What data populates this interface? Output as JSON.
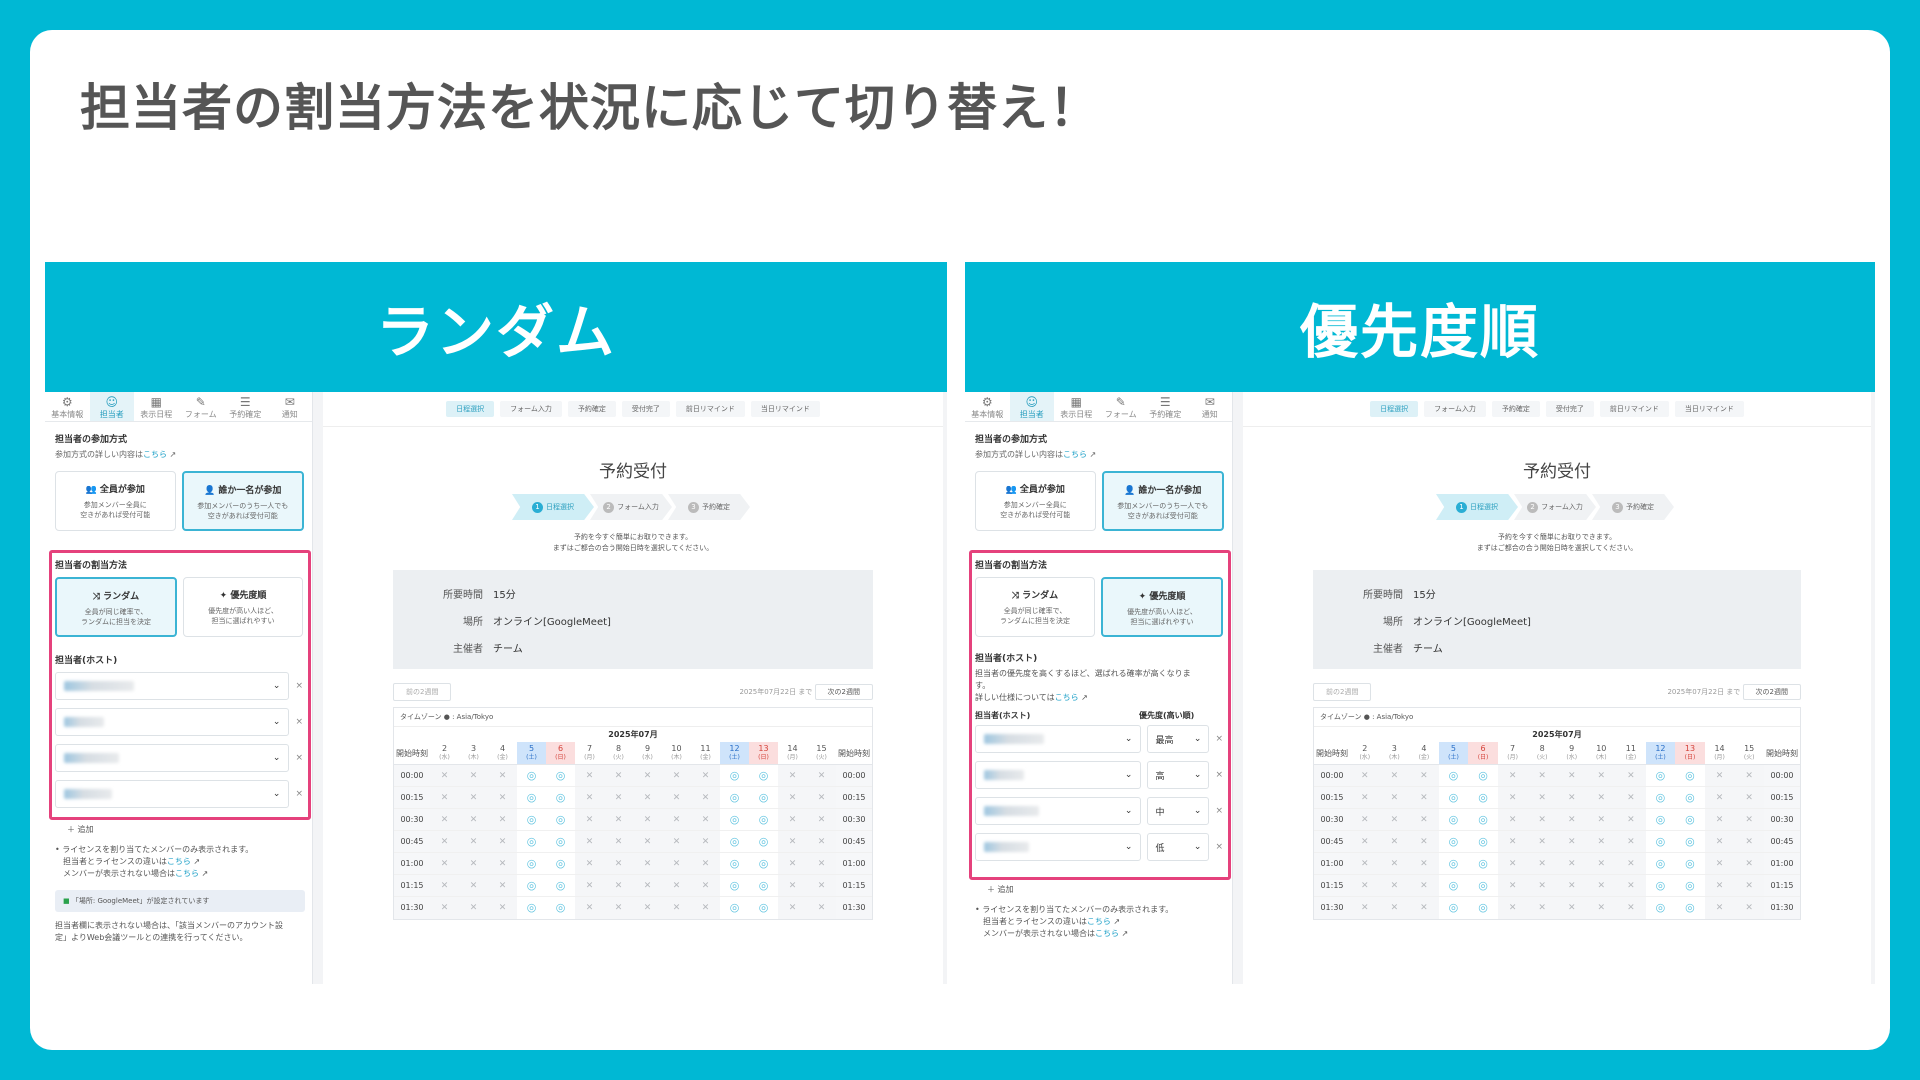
{
  "slide": {
    "title": "担当者の割当方法を状況に応じて切り替え！"
  },
  "panels": [
    {
      "banner": "ランダム",
      "tabs": [
        {
          "icon": "⚙",
          "label": "基本情報"
        },
        {
          "icon": "☺",
          "label": "担当者"
        },
        {
          "icon": "▦",
          "label": "表示日程"
        },
        {
          "icon": "✎",
          "label": "フォーム"
        },
        {
          "icon": "☰",
          "label": "予約確定"
        },
        {
          "icon": "✉",
          "label": "通知"
        }
      ],
      "join_title": "担当者の参加方式",
      "join_note": "参加方式の詳しい内容は",
      "link_here": "こちら",
      "join_all": {
        "title": "全員が参加",
        "desc1": "参加メンバー全員に",
        "desc2": "空きがあれば受付可能"
      },
      "join_one": {
        "title": "誰か一名が参加",
        "desc1": "参加メンバーのうち一人でも",
        "desc2": "空きがあれば受付可能"
      },
      "assign_title": "担当者の割当方法",
      "random": {
        "title": "ランダム",
        "desc1": "全員が同じ確率で、",
        "desc2": "ランダムに担当を決定"
      },
      "priority": {
        "title": "優先度順",
        "desc1": "優先度が高い人ほど、",
        "desc2": "担当に選ばれやすい"
      },
      "host_title": "担当者(ホスト)",
      "add": "＋ 追加",
      "note1": "• ライセンスを割り当てたメンバーのみ表示されます。",
      "note2": "担当者とライセンスの違いは",
      "note3": "メンバーが表示されない場合は",
      "gm_note": "「場所: GoogleMeet」が設定されています",
      "bottom1": "担当者欄に表示されない場合は、「該当メンバーのアカウント設",
      "bottom2": "定」よりWeb会議ツールとの連携を行ってください。"
    },
    {
      "banner": "優先度順",
      "host_desc1": "担当者の優先度を高くするほど、選ばれる確率が高くなりま",
      "host_desc2": "す。",
      "host_desc3": "詳しい仕様については",
      "col_host": "担当者(ホスト)",
      "col_prio": "優先度(高い順)",
      "priorities": [
        "最高",
        "高",
        "中",
        "低"
      ]
    }
  ],
  "booking": {
    "steps_bar": [
      "日程選択",
      "フォーム入力",
      "予約確定",
      "受付完了",
      "前日リマインド",
      "当日リマインド"
    ],
    "title": "予約受付",
    "chevrons": [
      {
        "num": "1",
        "label": "日程選択"
      },
      {
        "num": "2",
        "label": "フォーム入力"
      },
      {
        "num": "3",
        "label": "予約確定"
      }
    ],
    "intro1": "予約を今すぐ簡単にお取りできます。",
    "intro2": "まずはご都合の合う開始日時を選択してください。",
    "info": [
      {
        "k": "所要時間",
        "v": "15分"
      },
      {
        "k": "場所",
        "v": "オンライン[GoogleMeet]"
      },
      {
        "k": "主催者",
        "v": "チーム"
      }
    ],
    "prev": "前の2週間",
    "until": "2025年07月22日 まで",
    "next": "次の2週間",
    "timezone": "タイムゾーン ● : Asia/Tokyo",
    "month": "2025年07月",
    "start_label": "開始時刻",
    "days": [
      {
        "d": "2",
        "w": "(水)",
        "k": ""
      },
      {
        "d": "3",
        "w": "(木)",
        "k": ""
      },
      {
        "d": "4",
        "w": "(金)",
        "k": ""
      },
      {
        "d": "5",
        "w": "(土)",
        "k": "sat"
      },
      {
        "d": "6",
        "w": "(日)",
        "k": "sun"
      },
      {
        "d": "7",
        "w": "(月)",
        "k": ""
      },
      {
        "d": "8",
        "w": "(火)",
        "k": ""
      },
      {
        "d": "9",
        "w": "(水)",
        "k": ""
      },
      {
        "d": "10",
        "w": "(木)",
        "k": ""
      },
      {
        "d": "11",
        "w": "(金)",
        "k": ""
      },
      {
        "d": "12",
        "w": "(土)",
        "k": "sat"
      },
      {
        "d": "13",
        "w": "(日)",
        "k": "sun"
      },
      {
        "d": "14",
        "w": "(月)",
        "k": ""
      },
      {
        "d": "15",
        "w": "(火)",
        "k": ""
      }
    ],
    "times": [
      "00:00",
      "00:15",
      "00:30",
      "00:45",
      "01:00",
      "01:15",
      "01:30"
    ],
    "available_day_indexes": [
      3,
      4,
      10,
      11
    ]
  }
}
